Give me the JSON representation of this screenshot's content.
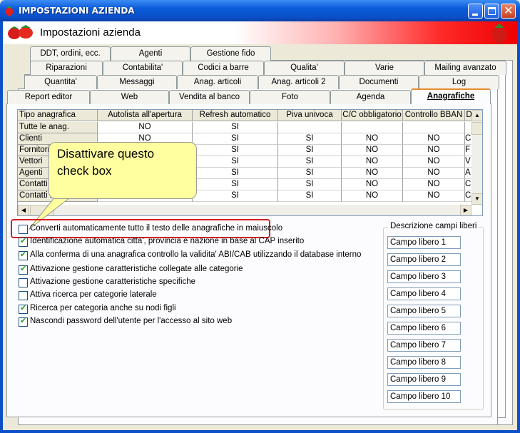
{
  "window": {
    "title": "IMPOSTAZIONI AZIENDA",
    "header_title": "Impostazioni azienda"
  },
  "tabs": {
    "row1": [
      "DDT, ordini, ecc.",
      "Agenti",
      "Gestione fido"
    ],
    "row2": [
      "Quantita'",
      "Messaggi",
      "Anag. articoli",
      "Anag. articoli 2",
      "Documenti",
      "Log"
    ],
    "row3": [
      "Riparazioni",
      "Contabilita'",
      "Codici a barre",
      "Qualita'",
      "Varie",
      "Mailing avanzato"
    ],
    "row4": [
      "Report editor",
      "Web",
      "Vendita al banco",
      "Foto",
      "Agenda",
      "Anagrafiche"
    ],
    "selected": "Anagrafiche"
  },
  "grid": {
    "columns": [
      "Tipo anagrafica",
      "Autolista all'apertura",
      "Refresh automatico",
      "Piva univoca",
      "C/C obbligatorio",
      "Controllo BBAN",
      "D"
    ],
    "rows": [
      [
        "Tutte le anag.",
        "NO",
        "SI",
        "",
        "",
        "",
        ""
      ],
      [
        "Clienti",
        "NO",
        "SI",
        "SI",
        "NO",
        "NO",
        "C"
      ],
      [
        "Fornitori",
        "",
        "SI",
        "SI",
        "NO",
        "NO",
        "F"
      ],
      [
        "Vettori",
        "",
        "SI",
        "SI",
        "NO",
        "NO",
        "V"
      ],
      [
        "Agenti",
        "",
        "SI",
        "SI",
        "NO",
        "NO",
        "A"
      ],
      [
        "Contatti",
        "",
        "SI",
        "SI",
        "NO",
        "NO",
        "C"
      ],
      [
        "Contatti 2",
        "",
        "SI",
        "SI",
        "NO",
        "NO",
        "C"
      ]
    ]
  },
  "callout": {
    "line1": "Disattivare questo",
    "line2": "check box"
  },
  "options": [
    {
      "label": "Converti automaticamente tutto il testo delle anagrafiche in maiuscolo",
      "checked": false
    },
    {
      "label": "Identificazione automatica citta', provincia e nazione in base al CAP inserito",
      "checked": true
    },
    {
      "label": "Alla conferma di una anagrafica controllo la validita' ABI/CAB utilizzando il database interno",
      "checked": true
    },
    {
      "label": "Attivazione gestione caratteristiche collegate alle categorie",
      "checked": true
    },
    {
      "label": "Attivazione gestione caratteristiche specifiche",
      "checked": false
    },
    {
      "label": "Attiva ricerca per categorie laterale",
      "checked": false
    },
    {
      "label": "Ricerca per categoria anche su nodi figli",
      "checked": true
    },
    {
      "label": "Nascondi password dell'utente per l'accesso al sito web",
      "checked": true
    }
  ],
  "free_fields": {
    "group_label": "Descrizione campi liberi",
    "values": [
      "Campo libero 1",
      "Campo libero 2",
      "Campo libero 3",
      "Campo libero 4",
      "Campo libero 5",
      "Campo libero 6",
      "Campo libero 7",
      "Campo libero 8",
      "Campo libero 9",
      "Campo libero 10"
    ]
  },
  "colors": {
    "titlebar": "#0b50c8",
    "header_accent": "#ee0000",
    "highlight": "#d42020",
    "callout": "#ffffa0"
  }
}
